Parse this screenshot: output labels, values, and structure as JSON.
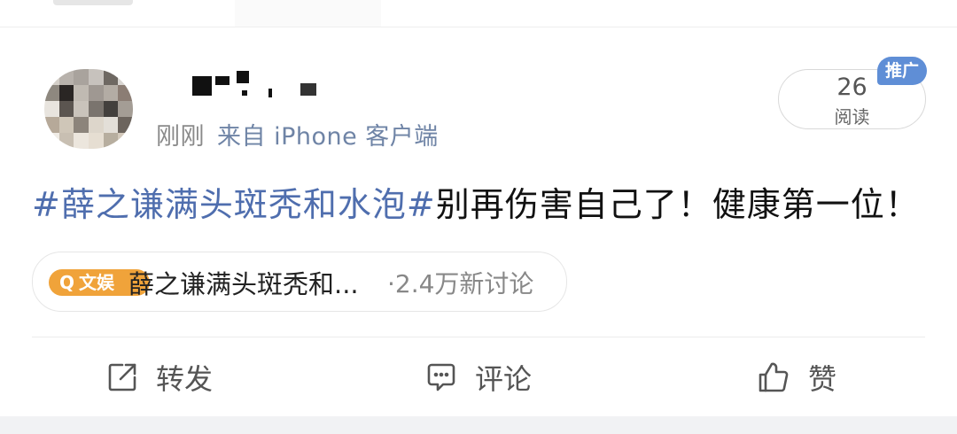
{
  "post": {
    "time": "刚刚",
    "source": "来自 iPhone 客户端",
    "hashtag": "#薛之谦满头斑秃和水泡#",
    "text": "别再伤害自己了！健康第一位！"
  },
  "read": {
    "count": "26",
    "label": "阅读"
  },
  "ad_badge": "推广",
  "topic": {
    "badge_icon": "Q",
    "badge": "文娱",
    "name": "薛之谦满头斑秃和...",
    "discussion": "·2.4万新讨论"
  },
  "actions": {
    "repost": "转发",
    "comment": "评论",
    "like": "赞"
  },
  "colors": {
    "hashtag": "#4f6eae",
    "source": "#6f84a6",
    "badge_orange": "#f0a33a",
    "ad_blue": "#5f8ed6"
  }
}
